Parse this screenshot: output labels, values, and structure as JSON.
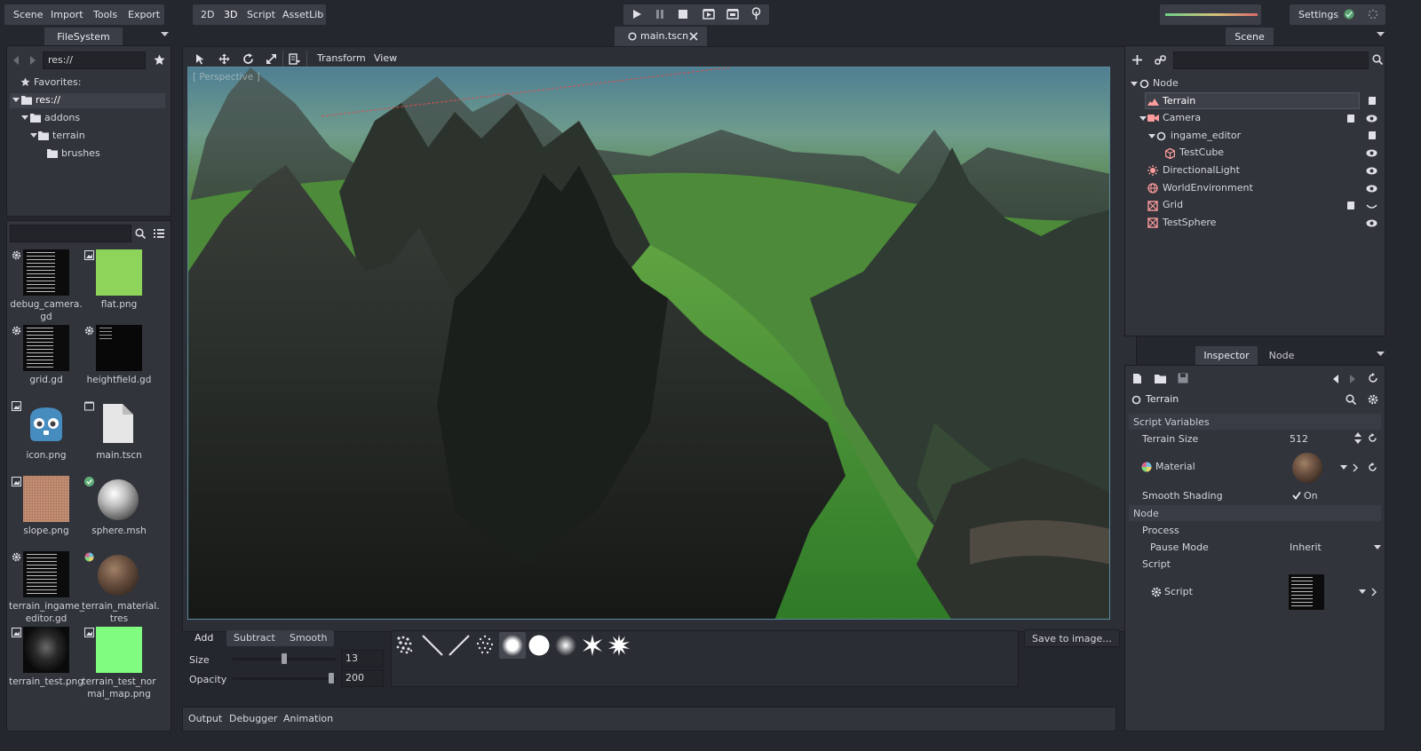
{
  "menu": {
    "scene": "Scene",
    "import": "Import",
    "tools": "Tools",
    "export": "Export"
  },
  "modes": {
    "d2": "2D",
    "d3": "3D",
    "script": "Script",
    "assetlib": "AssetLib"
  },
  "settings_label": "Settings",
  "filesystem": {
    "tab": "FileSystem",
    "path": "res://",
    "favorites": "Favorites:",
    "tree": [
      "res://",
      "addons",
      "terrain",
      "brushes"
    ],
    "files": [
      {
        "name": "debug_camera.\ngd",
        "kind": "script"
      },
      {
        "name": "flat.png",
        "kind": "image"
      },
      {
        "name": "grid.gd",
        "kind": "script"
      },
      {
        "name": "heightfield.gd",
        "kind": "script"
      },
      {
        "name": "icon.png",
        "kind": "image"
      },
      {
        "name": "main.tscn",
        "kind": "scene"
      },
      {
        "name": "slope.png",
        "kind": "image"
      },
      {
        "name": "sphere.msh",
        "kind": "mesh"
      },
      {
        "name": "terrain_ingame_\neditor.gd",
        "kind": "script"
      },
      {
        "name": "terrain_material.\ntres",
        "kind": "material"
      },
      {
        "name": "terrain_test.png",
        "kind": "image"
      },
      {
        "name": "terrain_test_nor\nmal_map.png",
        "kind": "image"
      }
    ]
  },
  "editor_tab": "main.tscn",
  "viewport": {
    "transform": "Transform",
    "view": "View",
    "perspective": "[ Perspective ]"
  },
  "brush": {
    "add": "Add",
    "subtract": "Subtract",
    "smooth": "Smooth",
    "size_label": "Size",
    "size_value": "13",
    "size_level": 0.5,
    "opacity_label": "Opacity",
    "opacity_value": "200",
    "opacity_level": 0.98,
    "save": "Save to image..."
  },
  "bottom_tabs": {
    "output": "Output",
    "debugger": "Debugger",
    "animation": "Animation"
  },
  "scene": {
    "tab": "Scene",
    "nodes": [
      {
        "label": "Node",
        "icon": "node-icon"
      },
      {
        "label": "Terrain",
        "icon": "terrain-icon"
      },
      {
        "label": "Camera",
        "icon": "camera-icon"
      },
      {
        "label": "ingame_editor",
        "icon": "node-icon"
      },
      {
        "label": "TestCube",
        "icon": "mesh-icon"
      },
      {
        "label": "DirectionalLight",
        "icon": "light-icon"
      },
      {
        "label": "WorldEnvironment",
        "icon": "world-icon"
      },
      {
        "label": "Grid",
        "icon": "mesh-instance-icon"
      },
      {
        "label": "TestSphere",
        "icon": "mesh-instance-icon"
      }
    ]
  },
  "inspector": {
    "tab": "Inspector",
    "node_tab": "Node",
    "object": "Terrain",
    "section_script_vars": "Script Variables",
    "terrain_size_label": "Terrain Size",
    "terrain_size_value": "512",
    "material_label": "Material",
    "smooth_label": "Smooth Shading",
    "smooth_value": "On",
    "section_node": "Node",
    "process": "Process",
    "pause_label": "Pause Mode",
    "pause_value": "Inherit",
    "script_section": "Script",
    "script_label": "Script"
  },
  "colors": {
    "accent": "#6fd087",
    "bg": "#25272e",
    "panel": "#31343b",
    "selection": "#3d4048"
  }
}
